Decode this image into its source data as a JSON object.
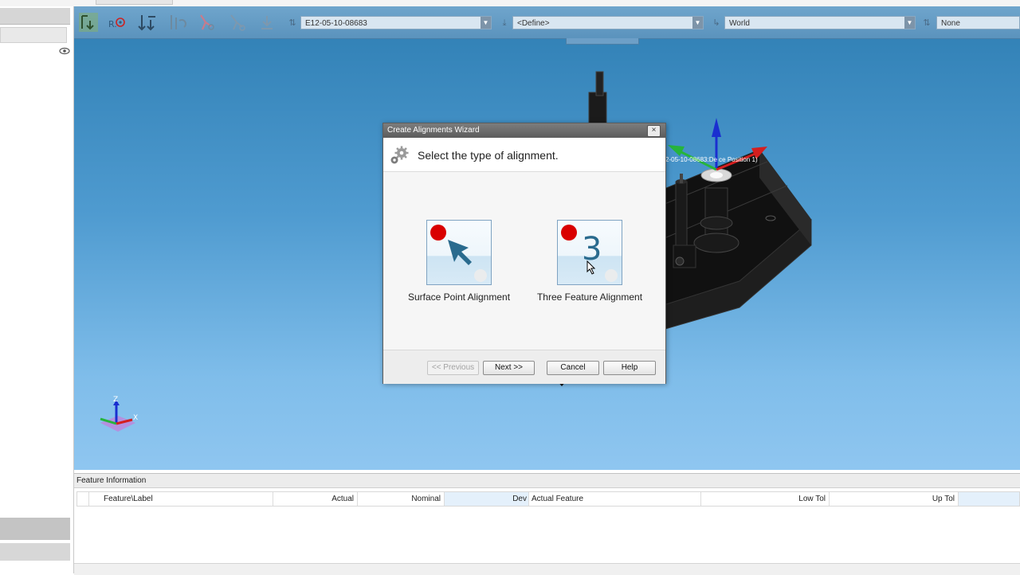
{
  "toolbar": {
    "combo_part": "E12-05-10-08683",
    "combo_alignment": "<Define>",
    "combo_coordinate": "World",
    "combo_last": "None"
  },
  "viewport": {
    "model_label": "2-05-10-08683:De  ce Position 1)",
    "triad_labels": {
      "z": "Z",
      "x": "X"
    }
  },
  "dialog": {
    "title": "Create Alignments Wizard",
    "close_label": "×",
    "heading": "Select the type of alignment.",
    "options": [
      {
        "label": "Surface Point Alignment",
        "icon": "arrow-cursor-icon"
      },
      {
        "label": "Three Feature Alignment",
        "icon": "number-three-icon",
        "number": "3"
      }
    ],
    "buttons": {
      "previous": "<< Previous",
      "next": "Next >>",
      "cancel": "Cancel",
      "help": "Help"
    }
  },
  "feature_info": {
    "title": "Feature Information",
    "columns": [
      "Feature\\Label",
      "Actual",
      "Nominal",
      "Dev",
      "Actual Feature",
      "Low Tol",
      "Up Tol"
    ],
    "rows": []
  },
  "colors": {
    "viewport_top": "#2e7eb3",
    "viewport_bottom": "#8fc6f0",
    "marker_red": "#d90000",
    "icon_blue": "#2a6b8e"
  }
}
